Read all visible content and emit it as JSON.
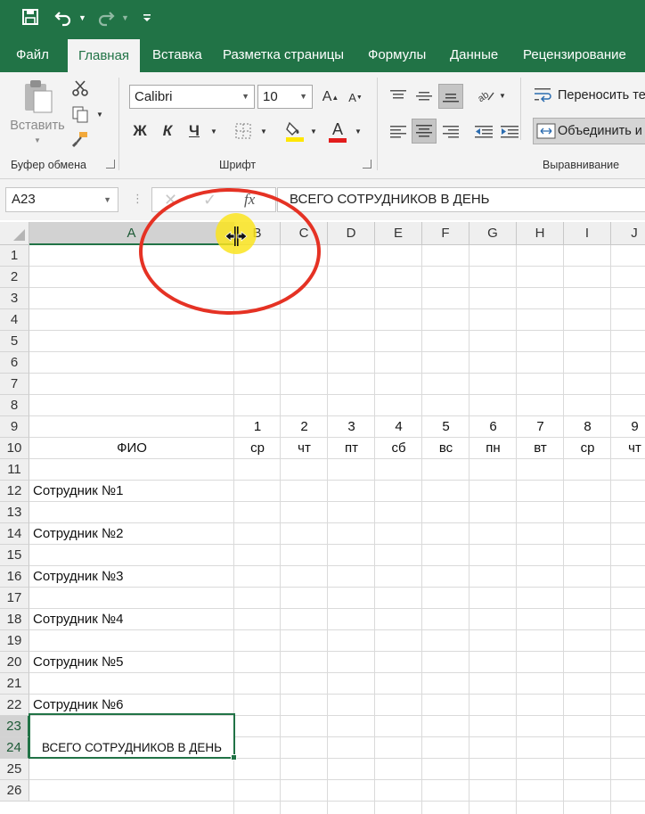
{
  "menu_tabs": [
    {
      "label": "Файл"
    },
    {
      "label": "Главная"
    },
    {
      "label": "Вставка"
    },
    {
      "label": "Разметка страницы"
    },
    {
      "label": "Формулы"
    },
    {
      "label": "Данные"
    },
    {
      "label": "Рецензирование"
    }
  ],
  "ribbon": {
    "clipboard": {
      "paste_label": "Вставить",
      "group_label": "Буфер обмена"
    },
    "font": {
      "font_name": "Calibri",
      "font_size": "10",
      "grow_label": "A",
      "shrink_label": "A",
      "bold_label": "Ж",
      "italic_label": "К",
      "underline_label": "Ч",
      "font_color_label": "A",
      "group_label": "Шрифт"
    },
    "alignment": {
      "wrap_text_label": "Переносить те",
      "merge_label": "Объединить и",
      "group_label": "Выравнивание"
    }
  },
  "formula_bar": {
    "name_box": "A23",
    "fx_label": "fx",
    "content": "ВСЕГО СОТРУДНИКОВ В ДЕНЬ"
  },
  "sheet": {
    "columns": [
      "A",
      "B",
      "C",
      "D",
      "E",
      "F",
      "G",
      "H",
      "I",
      "J"
    ],
    "rows": [
      "1",
      "2",
      "3",
      "4",
      "5",
      "6",
      "7",
      "8",
      "9",
      "10",
      "11",
      "12",
      "13",
      "14",
      "15",
      "16",
      "17",
      "18",
      "19",
      "20",
      "21",
      "22",
      "23",
      "24",
      "25",
      "26"
    ],
    "day_numbers": [
      "1",
      "2",
      "3",
      "4",
      "5",
      "6",
      "7",
      "8",
      "9"
    ],
    "weekdays": [
      "ср",
      "чт",
      "пт",
      "сб",
      "вс",
      "пн",
      "вт",
      "ср",
      "чт"
    ],
    "fio_header": "ФИО",
    "employees": [
      "Сотрудник №1",
      "Сотрудник №2",
      "Сотрудник №3",
      "Сотрудник №4",
      "Сотрудник №5",
      "Сотрудник №6"
    ],
    "total_label": "ВСЕГО СОТРУДНИКОВ В ДЕНЬ"
  },
  "colors": {
    "excel_green": "#217346",
    "annotation_red": "#e53224",
    "cursor_highlight": "#fae41e"
  }
}
